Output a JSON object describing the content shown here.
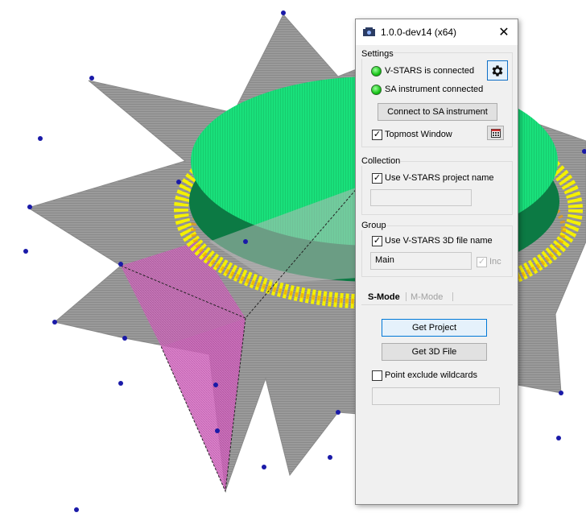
{
  "window": {
    "title": "1.0.0-dev14 (x64)",
    "close_glyph": "✕"
  },
  "settings": {
    "group_label": "Settings",
    "vstars_status": "V-STARS is connected",
    "sa_status": "SA instrument connected",
    "connect_button": "Connect to SA instrument",
    "topmost_label": "Topmost Window",
    "topmost_checked": true
  },
  "collection": {
    "group_label": "Collection",
    "use_project_label": "Use V-STARS project name",
    "use_project_checked": true,
    "name_value": ""
  },
  "group": {
    "group_label": "Group",
    "use_file_label": "Use V-STARS 3D file name",
    "use_file_checked": true,
    "name_value": "Main",
    "inc_label": "Inc",
    "inc_checked": true
  },
  "tabs": [
    {
      "label": "S-Mode",
      "active": true
    },
    {
      "label": "M-Mode",
      "active": false
    }
  ],
  "smode": {
    "get_project_button": "Get Project",
    "get_3d_file_button": "Get 3D File",
    "point_exclude_label": "Point exclude wildcards",
    "point_exclude_checked": false,
    "wildcards_value": ""
  },
  "colors": {
    "status_ok": "#18c518",
    "accent": "#0078d7"
  },
  "icons": [
    "app-icon",
    "close-icon",
    "gear-icon",
    "calendar-icon",
    "checkmark-icon"
  ]
}
